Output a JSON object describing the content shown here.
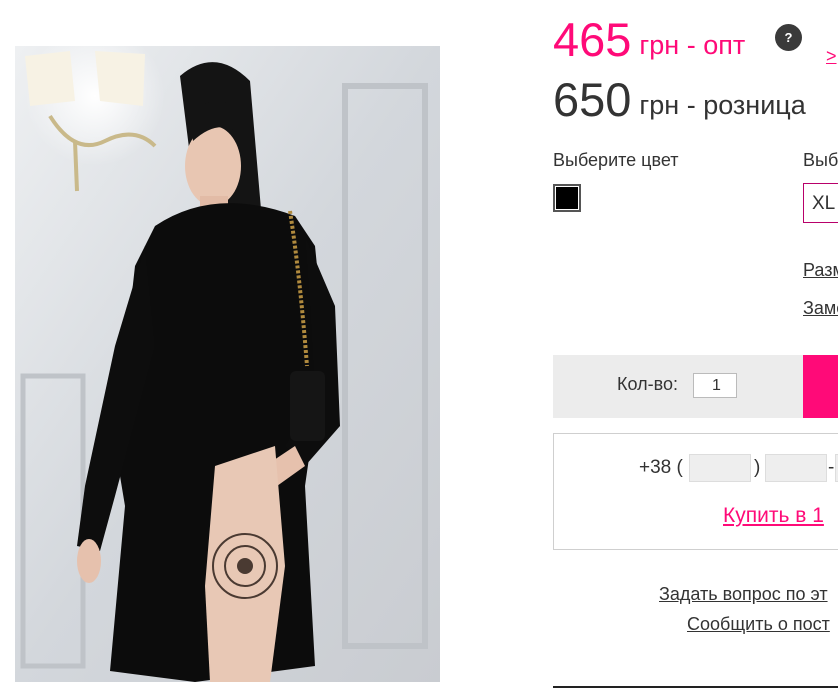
{
  "price": {
    "wholesale_value": "465",
    "wholesale_label": "грн - опт",
    "retail_value": "650",
    "retail_label": "грн - розница",
    "help_icon": "?",
    "more_link": ">"
  },
  "options": {
    "color_label": "Выберите цвет",
    "size_label": "Выб",
    "selected_color": "#000000",
    "selected_size": "XL",
    "size_table_link": "Разм",
    "measure_link": "Заме"
  },
  "cart": {
    "qty_label": "Кол-во:",
    "qty_value": "1"
  },
  "one_click": {
    "phone_prefix": "+38 (",
    "paren_close": ")",
    "dash": "-",
    "buy_link": "Купить в 1"
  },
  "links": {
    "ask_question": "Задать вопрос по эт",
    "report": "Сообщить о пост"
  },
  "colors": {
    "accent": "#ff0a78",
    "text": "#333333",
    "qty_bar_bg": "#ececec"
  }
}
